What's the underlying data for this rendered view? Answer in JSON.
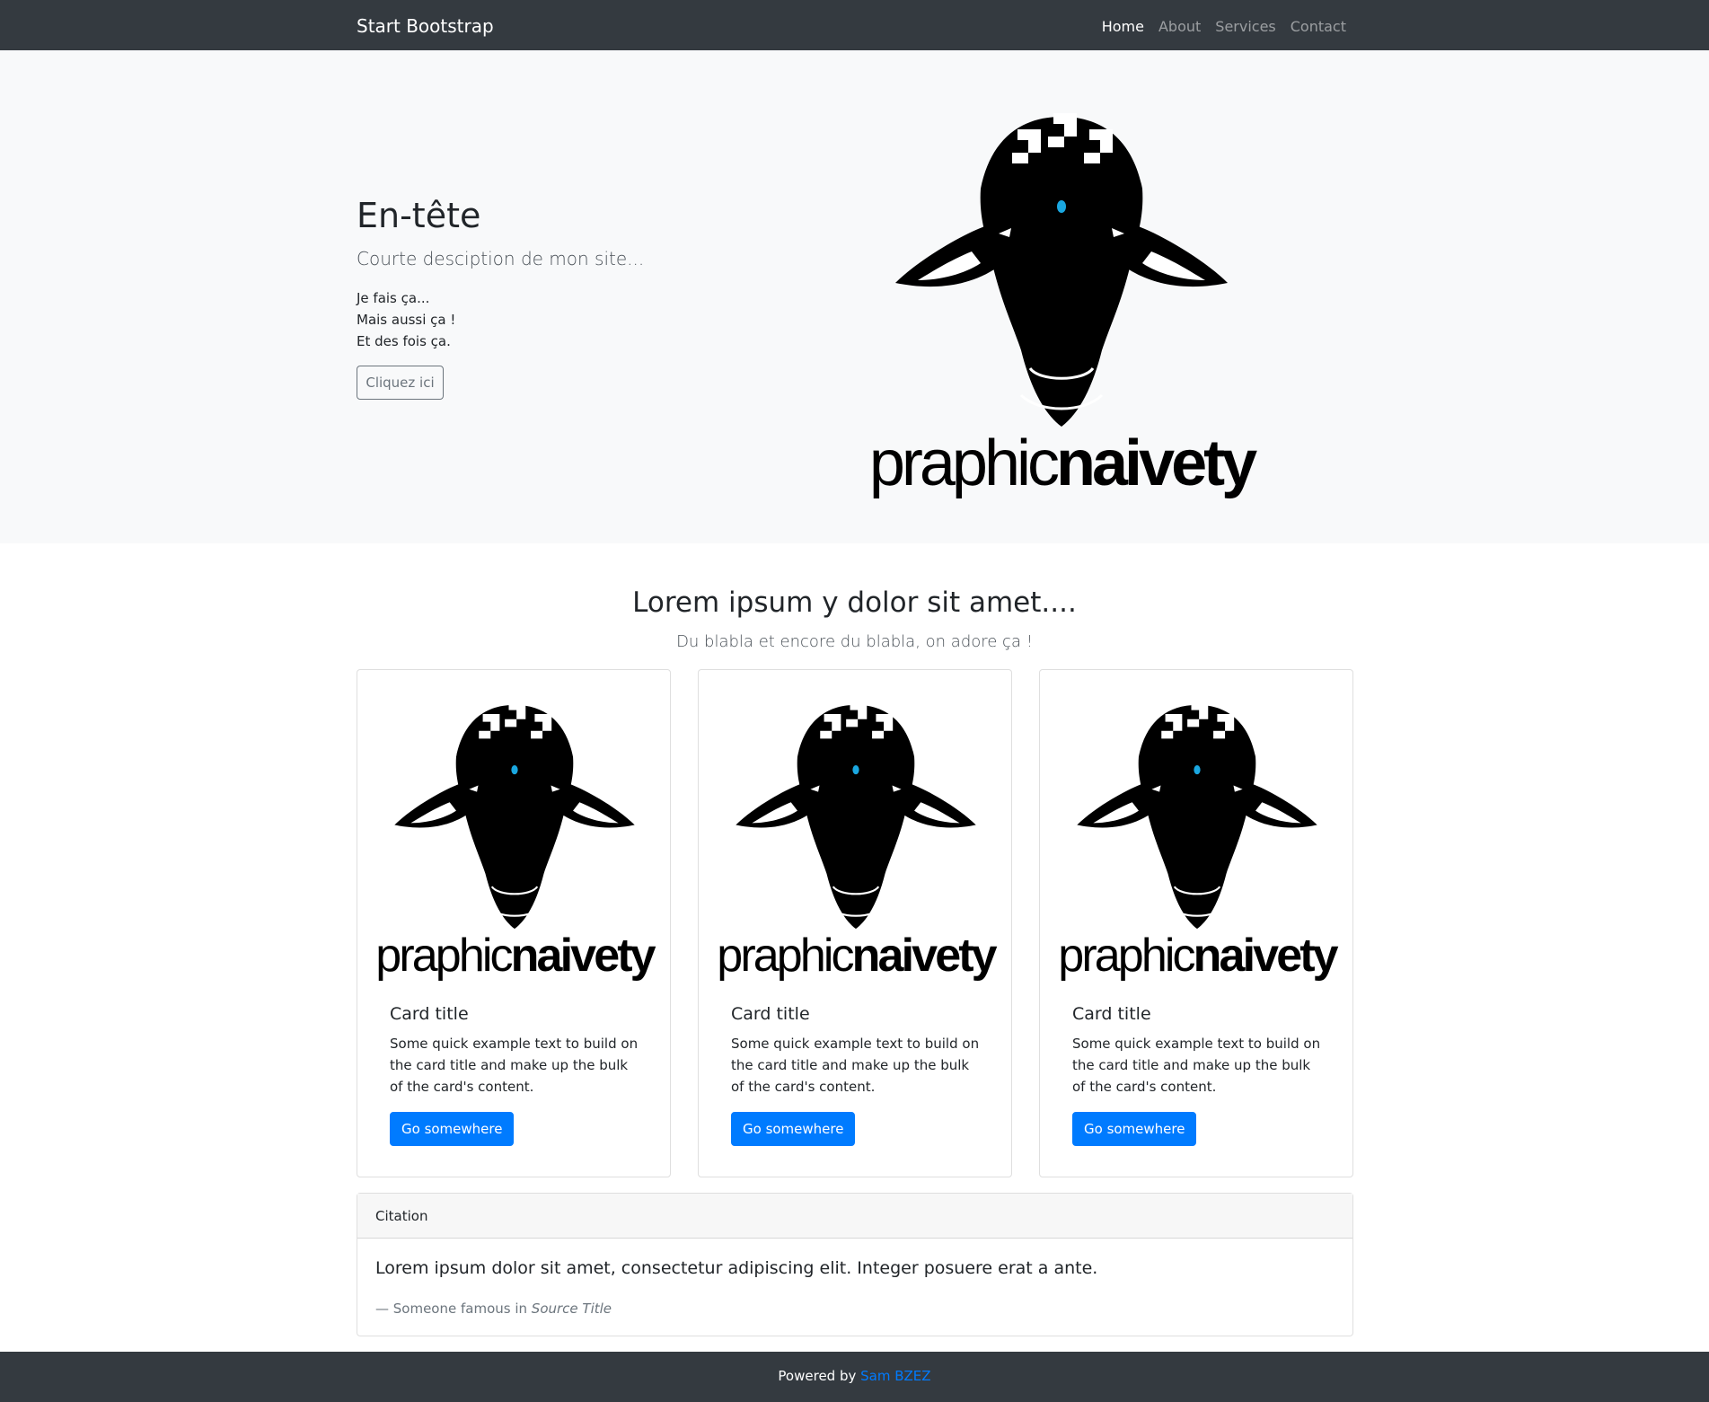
{
  "navbar": {
    "brand": "Start Bootstrap",
    "items": [
      {
        "label": "Home",
        "active": true
      },
      {
        "label": "About",
        "active": false
      },
      {
        "label": "Services",
        "active": false
      },
      {
        "label": "Contact",
        "active": false
      }
    ]
  },
  "hero": {
    "title": "En-tête",
    "lead": "Courte desciption de mon site...",
    "lines": [
      "Je fais ça...",
      "Mais aussi ça !",
      "Et des fois ça."
    ],
    "button_label": "Cliquez ici",
    "logo": {
      "text_light": "praphic",
      "text_bold": "naivety"
    }
  },
  "section": {
    "title": "Lorem ipsum y dolor sit amet....",
    "subtitle": "Du blabla et encore du blabla, on adore ça !"
  },
  "cards": [
    {
      "title": "Card title",
      "text": "Some quick example text to build on the card title and make up the bulk of the card's content.",
      "button": "Go somewhere",
      "logo_light": "praphic",
      "logo_bold": "naivety"
    },
    {
      "title": "Card title",
      "text": "Some quick example text to build on the card title and make up the bulk of the card's content.",
      "button": "Go somewhere",
      "logo_light": "praphic",
      "logo_bold": "naivety"
    },
    {
      "title": "Card title",
      "text": "Some quick example text to build on the card title and make up the bulk of the card's content.",
      "button": "Go somewhere",
      "logo_light": "praphic",
      "logo_bold": "naivety"
    }
  ],
  "citation": {
    "header": "Citation",
    "quote": "Lorem ipsum dolor sit amet, consectetur adipiscing elit. Integer posuere erat a ante.",
    "attribution_prefix": "— Someone famous in ",
    "source": "Source Title"
  },
  "footer": {
    "prefix": "Powered by ",
    "link": "Sam BZEZ"
  },
  "colors": {
    "navbar_bg": "#343a40",
    "hero_bg": "#f8f9fa",
    "primary": "#007bff",
    "logo_accent": "#1aa7e0"
  }
}
